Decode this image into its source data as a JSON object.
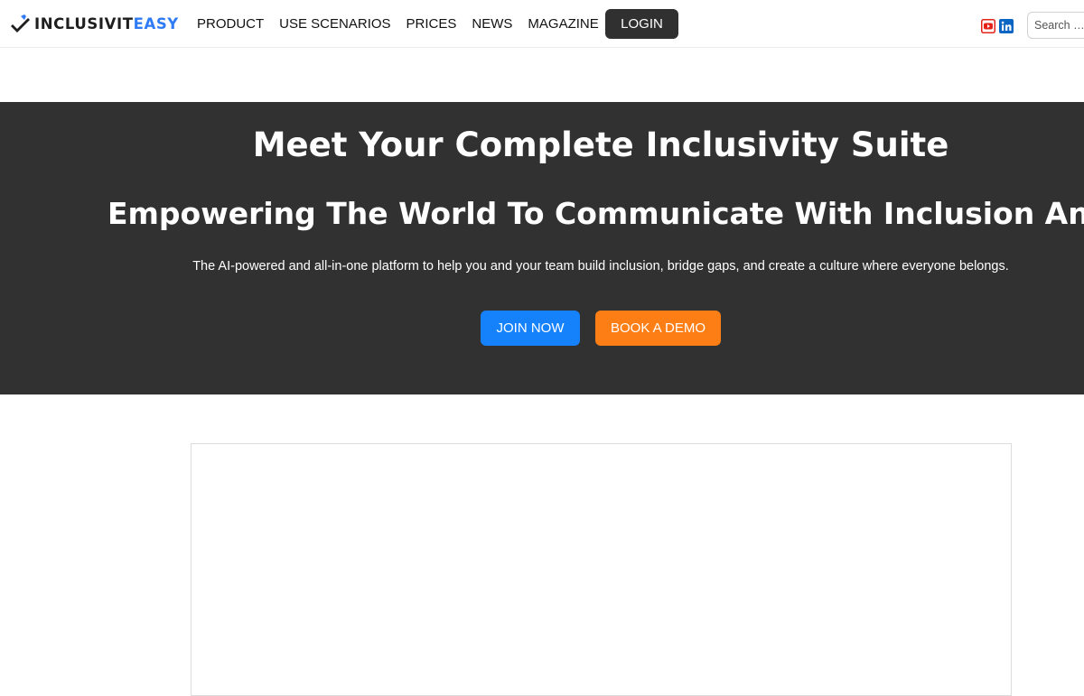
{
  "header": {
    "logo": {
      "text_main": "INCLUSIVIT",
      "text_accent": "EASY",
      "icon": "checkmark-pencil-icon"
    },
    "nav": [
      {
        "label": "PRODUCT"
      },
      {
        "label": "USE SCENARIOS"
      },
      {
        "label": "PRICES"
      },
      {
        "label": "NEWS"
      },
      {
        "label": "MAGAZINE"
      }
    ],
    "login_label": "LOGIN",
    "social": [
      {
        "icon": "youtube-icon",
        "color": "#e62117"
      },
      {
        "icon": "linkedin-icon",
        "color": "#0a66c2"
      }
    ],
    "search": {
      "placeholder": "Search …",
      "value": ""
    }
  },
  "hero": {
    "title": "Meet Your Complete Inclusivity Suite",
    "subtitle": "Empowering The World To Communicate With Inclusion And Impact",
    "description": "The AI-powered and all-in-one platform to help you and your team build inclusion, bridge gaps, and create a culture where everyone belongs.",
    "join_label": "JOIN NOW",
    "demo_label": "BOOK A DEMO"
  },
  "colors": {
    "hero_background": "#313131",
    "primary_button": "#1581fb",
    "secondary_button": "#fd7e14",
    "logo_accent": "#2f7bf5",
    "login_button": "#303030"
  }
}
